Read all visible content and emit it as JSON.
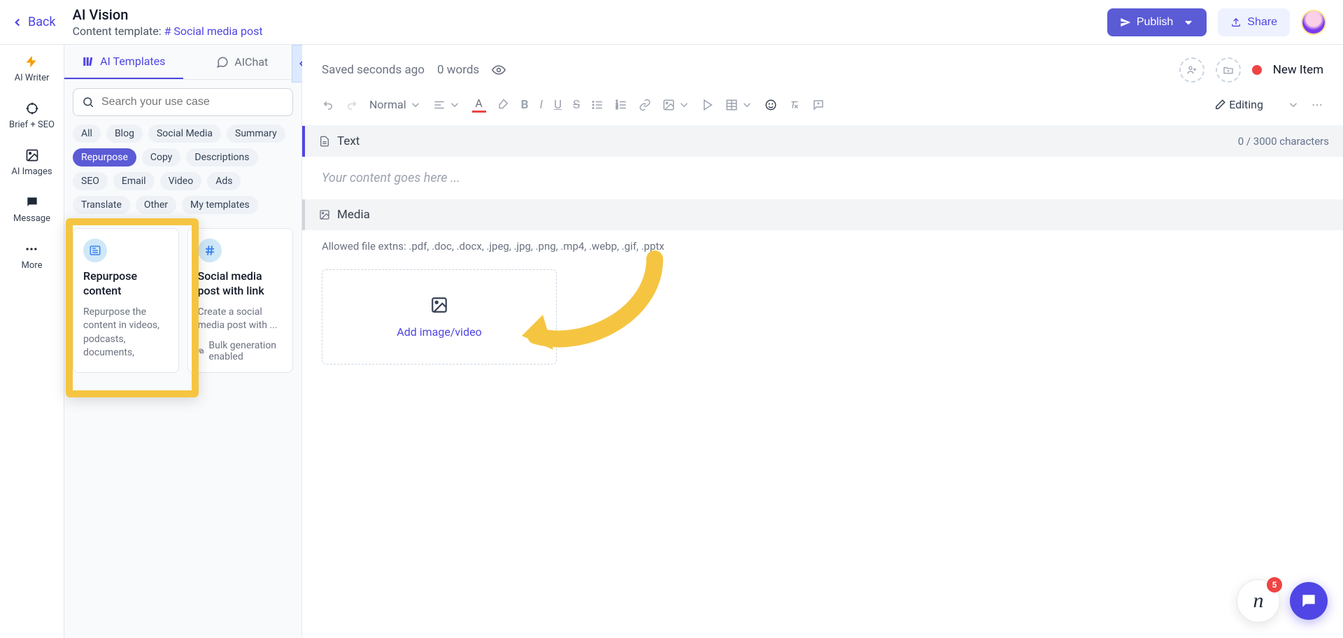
{
  "header": {
    "back_label": "Back",
    "title": "AI Vision",
    "template_prefix": "Content template: ",
    "template_link": "# Social media post",
    "publish_label": "Publish",
    "share_label": "Share"
  },
  "rail": {
    "items": [
      {
        "label": "AI Writer"
      },
      {
        "label": "Brief + SEO"
      },
      {
        "label": "AI Images"
      },
      {
        "label": "Message"
      },
      {
        "label": "More"
      }
    ]
  },
  "panel": {
    "tabs": {
      "templates": "AI Templates",
      "chat": "AIChat"
    },
    "search_placeholder": "Search your use case",
    "pills": [
      "All",
      "Blog",
      "Social Media",
      "Summary",
      "Repurpose",
      "Copy",
      "Descriptions",
      "SEO",
      "Email",
      "Video",
      "Ads",
      "Translate",
      "Other",
      "My templates"
    ],
    "active_pill": "Repurpose",
    "cards": [
      {
        "title": "Repurpose content",
        "desc": "Repurpose the content in videos, podcasts, documents,"
      },
      {
        "title": "Social media post with link",
        "desc": "Create a social media post with ...",
        "foot": "Bulk generation enabled"
      }
    ]
  },
  "editor": {
    "saved_text": "Saved seconds ago",
    "word_count": "0 words",
    "status_text": "New Item",
    "style_label": "Normal",
    "editing_label": "Editing",
    "text_section": "Text",
    "char_counter": "0 / 3000 characters",
    "placeholder": "Your content goes here ...",
    "media_section": "Media",
    "allowed_ext": "Allowed file extns: .pdf, .doc, .docx, .jpeg, .jpg, .png, .mp4, .webp, .gif, .pptx",
    "dropzone_label": "Add image/video"
  },
  "widgets": {
    "badge_count": "5"
  }
}
